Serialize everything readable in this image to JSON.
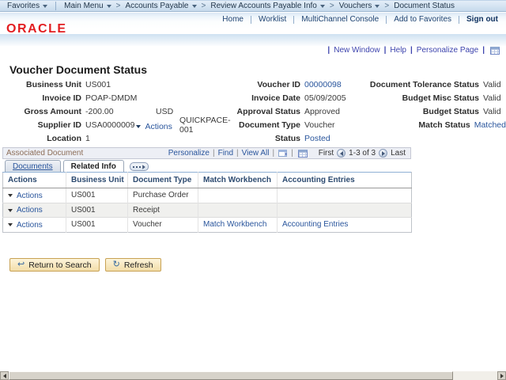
{
  "colors": {
    "oracle_red": "#e21e21",
    "link_blue": "#29559c",
    "nav_bar_blue": "#c6daec",
    "group_title_brown": "#8c6d58",
    "button_face": "#f7e7bd"
  },
  "breadcrumb": {
    "favorites": "Favorites",
    "main_menu": "Main Menu",
    "path": [
      "Accounts Payable",
      "Review Accounts Payable Info",
      "Vouchers",
      "Document Status"
    ]
  },
  "header": {
    "logo": "ORACLE",
    "links": [
      "Home",
      "Worklist",
      "MultiChannel Console",
      "Add to Favorites"
    ],
    "sign_out": "Sign out"
  },
  "page_links": {
    "new_window": "New Window",
    "help": "Help",
    "personalize_page": "Personalize Page"
  },
  "page": {
    "title": "Voucher Document Status"
  },
  "fields": {
    "col1": [
      {
        "label": "Business Unit",
        "value": "US001"
      },
      {
        "label": "Invoice ID",
        "value": "POAP-DMDM"
      },
      {
        "label": "Gross Amount",
        "value": "-200.00",
        "extra": "USD"
      },
      {
        "label": "Supplier ID",
        "value": "USA0000009",
        "action": "Actions",
        "extra": "QUICKPACE-001"
      },
      {
        "label": "Location",
        "value": "1"
      }
    ],
    "col2": [
      {
        "label": "Voucher ID",
        "value": "00000098"
      },
      {
        "label": "Invoice Date",
        "value": "05/09/2005"
      },
      {
        "label": "Approval Status",
        "value": "Approved"
      },
      {
        "label": "Document Type",
        "value": "Voucher"
      },
      {
        "label": "Status",
        "value": "Posted"
      }
    ],
    "col3": [
      {
        "label": "Document Tolerance Status",
        "value": "Valid"
      },
      {
        "label": "Budget Misc Status",
        "value": "Valid"
      },
      {
        "label": "Budget Status",
        "value": "Valid"
      },
      {
        "label": "Match Status",
        "value": "Matched"
      }
    ]
  },
  "group": {
    "title": "Associated Document",
    "toolbar": {
      "personalize": "Personalize",
      "find": "Find",
      "view_all": "View All",
      "first": "First",
      "range": "1-3 of 3",
      "last": "Last"
    },
    "tabs": {
      "documents": "Documents",
      "related_info": "Related Info"
    },
    "table": {
      "headers": [
        "Actions",
        "Business Unit",
        "Document Type",
        "Match Workbench",
        "Accounting Entries"
      ],
      "rows": [
        {
          "actions": "Actions",
          "business_unit": "US001",
          "document_type": "Purchase Order",
          "match_workbench": "",
          "accounting_entries": ""
        },
        {
          "actions": "Actions",
          "business_unit": "US001",
          "document_type": "Receipt",
          "match_workbench": "",
          "accounting_entries": ""
        },
        {
          "actions": "Actions",
          "business_unit": "US001",
          "document_type": "Voucher",
          "match_workbench": "Match Workbench",
          "accounting_entries": "Accounting Entries"
        }
      ]
    }
  },
  "buttons": {
    "return_to_search": "Return to Search",
    "refresh": "Refresh"
  },
  "icons": {
    "return_to_search": "↩",
    "refresh": "↻"
  }
}
